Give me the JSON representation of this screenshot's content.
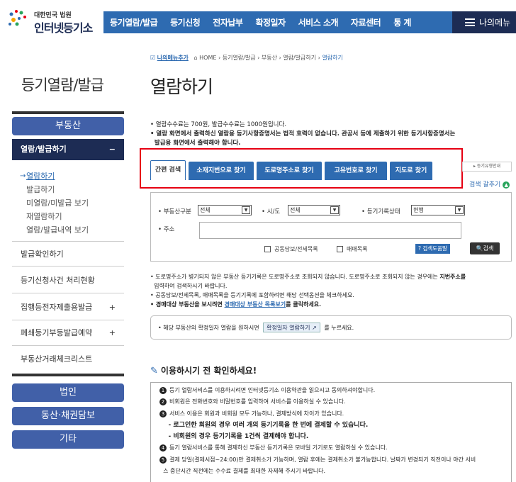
{
  "header": {
    "logo_small": "대한민국 법원",
    "logo_big": "인터넷등기소",
    "nav": [
      "등기열람/발급",
      "등기신청",
      "전자납부",
      "확정일자",
      "서비스 소개",
      "자료센터",
      "통 계"
    ],
    "my_menu": "나의메뉴"
  },
  "sidebar": {
    "title": "등기열람/발급",
    "section": "부동산",
    "open_item": "열람/발급하기",
    "open_toggle": "−",
    "sub_items": [
      "열람하기",
      "발급하기",
      "미열람/미발급 보기",
      "재열람하기",
      "열람/발급내역 보기"
    ],
    "items": [
      {
        "label": "발급확인하기",
        "toggle": ""
      },
      {
        "label": "등기신청사건 처리현황",
        "toggle": ""
      },
      {
        "label": "집행등전자제출용발급",
        "toggle": "+"
      },
      {
        "label": "폐쇄등기부등발급예약",
        "toggle": "+"
      },
      {
        "label": "부동산거래체크리스트",
        "toggle": ""
      }
    ],
    "buttons": [
      "법인",
      "동산·채권담보",
      "기타"
    ]
  },
  "breadcrumb": {
    "fav": "나의메뉴추가",
    "path": "HOME › 등기열람/발급 › 부동산 › 열람/발급하기 › ",
    "current": "열람하기"
  },
  "main": {
    "title": "열람하기",
    "notes": [
      "• 열람수수료는 700원, 발급수수료는 1000원입니다.",
      "• 열람 화면에서 출력하신 열람용 등기사항증명서는 법적 효력이 없습니다. 관공서 등에 제출하기 위한 등기사항증명서는",
      "  발급용 화면에서 출력해야 합니다."
    ],
    "tabs": [
      "간편 검색",
      "소재지번으로 찾기",
      "도로명주소로 찾기",
      "고유번호로 찾기",
      "지도로 찾기"
    ],
    "doc_button": "등기유형안내",
    "count_label": "검색 갈추기"
  },
  "search": {
    "type_label": "부동산구분",
    "type_value": "전체",
    "region_label": "시/도",
    "region_value": "전체",
    "status_label": "등기기록상태",
    "status_value": "현행",
    "address_label": "주소",
    "address_value": "",
    "check1": "공동담보/전세목록",
    "check2": "매매목록",
    "help": "검색도움말",
    "search_btn": "검색"
  },
  "notes2": {
    "line1a": "• 도로명주소가 병기되지 않은 부동산 등기기록은 도로명주소로 조회되지 않습니다. 도로명주소로 조회되지 않는 경우에는 ",
    "line1b": "지번주소를",
    "line2": "  입력하여 검색하시기 바랍니다.",
    "line3": "• 공동담보/전세목록, 매매목록을 등기기록에 포함하려면 해당 선택옵션을 체크하세요.",
    "line4a": "• 경매대상 부동산을 보시려면 ",
    "line4link": "경매대상 부동산 목록보기",
    "line4b": "를 클릭하세요."
  },
  "info": {
    "text1": "• 해당 부동산의 확정일자 열람을 원하시면",
    "button": "확정일자 열람하기 ↗",
    "text2": "를 누르세요."
  },
  "check": {
    "title": "이용하시기 전 확인하세요!",
    "items": [
      "등기 열람서비스를 이용하시려면 인터넷등기소 이용약관을 읽으시고 동의하셔야합니다.",
      "비회원은 전화번호와 비밀번호를 입력하여 서비스를 이용하실 수 있습니다.",
      "서비스 이용은 회원과 비회원 모두 가능하나, 결제방식에 차이가 있습니다.",
      "    - 로그인한 회원의 경우 여러 개의 등기기록을 한 번에 결제할 수 있습니다.",
      "    - 비회원의 경우 등기기록을 1건씩 결제해야 합니다.",
      "등기 열람서비스를 통해 결제하신 부동산 등기기록은 모바일 기기로도 열람하실 수 있습니다.",
      "결제 당일(결제시점~24:00)만 결제취소가 가능하며, 열람 후에는 결제취소가 불가능합니다. 날짜가 변경되기 직전이나 야간 서비",
      "  스 중단시간 직전에는 수수료 결제를 최대한 자제해 주시기 바랍니다."
    ],
    "nums": [
      "1",
      "2",
      "3",
      "",
      "",
      "4",
      "5",
      ""
    ]
  }
}
